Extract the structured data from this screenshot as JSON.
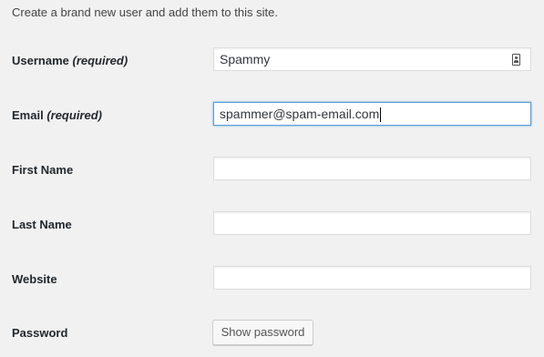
{
  "intro_text": "Create a brand new user and add them to this site.",
  "fields": {
    "username": {
      "label": "Username",
      "required_note": "(required)",
      "value": "Spammy",
      "icon": "contact-card-icon"
    },
    "email": {
      "label": "Email",
      "required_note": "(required)",
      "value": "spammer@spam-email.com"
    },
    "first_name": {
      "label": "First Name",
      "value": ""
    },
    "last_name": {
      "label": "Last Name",
      "value": ""
    },
    "website": {
      "label": "Website",
      "value": ""
    },
    "password": {
      "label": "Password",
      "button_label": "Show password"
    }
  },
  "colors": {
    "background": "#f1f1f1",
    "focus_border": "#5b9dd9"
  }
}
